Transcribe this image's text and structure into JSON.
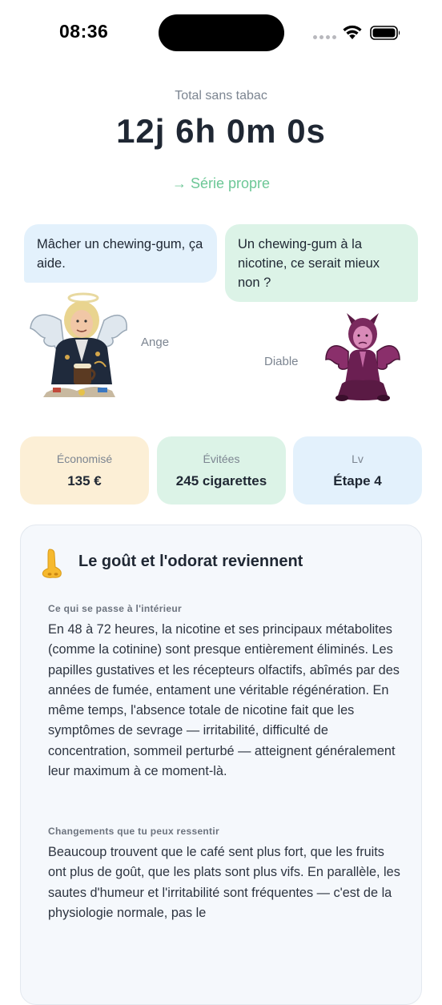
{
  "status_bar": {
    "time": "08:36"
  },
  "header": {
    "total_label": "Total sans tabac",
    "total_value": "12j 6h 0m 0s",
    "streak_link": "→ Série propre"
  },
  "dialogue": {
    "angel": {
      "message": "Mâcher un chewing-gum, ça aide.",
      "name": "Ange",
      "icon": "angel-character"
    },
    "devil": {
      "message": "Un chewing-gum à la nicotine, ce serait mieux non ?",
      "name": "Diable",
      "icon": "devil-character"
    }
  },
  "stats": [
    {
      "label": "Économisé",
      "value": "135 €",
      "color": "#fcefd6"
    },
    {
      "label": "Évitées",
      "value": "245 cigarettes",
      "color": "#dcf3e7"
    },
    {
      "label": "Lv",
      "value": "Étape 4",
      "color": "#e3f1fc"
    }
  ],
  "milestone": {
    "icon": "nose-icon",
    "title": "Le goût et l'odorat reviennent",
    "sections": [
      {
        "heading": "Ce qui se passe à l'intérieur",
        "text": "En 48 à 72 heures, la nicotine et ses principaux métabolites (comme la cotinine) sont presque entièrement éliminés. Les papilles gustatives et les récepteurs olfactifs, abîmés par des années de fumée, entament une véritable régénération. En même temps, l'absence totale de nicotine fait que les symptômes de sevrage — irritabilité, difficulté de concentration, sommeil perturbé — atteignent généralement leur maximum à ce moment-là."
      },
      {
        "heading": "Changements que tu peux ressentir",
        "text": "Beaucoup trouvent que le café sent plus fort, que les fruits ont plus de goût, que les plats sont plus vifs. En parallèle, les sautes d'humeur et l'irritabilité sont fréquentes — c'est de la physiologie normale, pas le"
      }
    ]
  },
  "colors": {
    "accent_green": "#6cc796",
    "text_dark": "#1f2733",
    "text_muted": "#7c8591"
  }
}
